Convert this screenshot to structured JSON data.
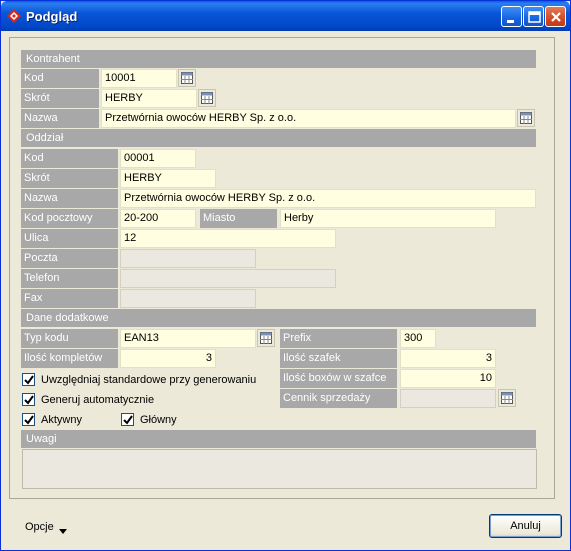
{
  "window": {
    "title": "Podgląd",
    "title_color": "#0a56d8"
  },
  "kontrahent": {
    "header": "Kontrahent",
    "kod_label": "Kod",
    "kod_value": "10001",
    "skrot_label": "Skrót",
    "skrot_value": "HERBY",
    "nazwa_label": "Nazwa",
    "nazwa_value": "Przetwórnia owoców HERBY Sp. z o.o."
  },
  "oddzial": {
    "header": "Oddział",
    "kod_label": "Kod",
    "kod_value": "00001",
    "skrot_label": "Skrót",
    "skrot_value": "HERBY",
    "nazwa_label": "Nazwa",
    "nazwa_value": "Przetwórnia owoców HERBY Sp. z o.o.",
    "kod_pocztowy_label": "Kod pocztowy",
    "kod_pocztowy_value": "20-200",
    "miasto_label": "Miasto",
    "miasto_value": "Herby",
    "ulica_label": "Ulica",
    "ulica_value": "12",
    "poczta_label": "Poczta",
    "poczta_value": "",
    "telefon_label": "Telefon",
    "telefon_value": "",
    "fax_label": "Fax",
    "fax_value": ""
  },
  "dane_dodatkowe": {
    "header": "Dane dodatkowe",
    "typ_kodu_label": "Typ kodu",
    "typ_kodu_value": "EAN13",
    "ilosc_kompletow_label": "Ilość kompletów",
    "ilosc_kompletow_value": "3",
    "prefix_label": "Prefix",
    "prefix_value": "300",
    "ilosc_szafek_label": "Ilość szafek",
    "ilosc_szafek_value": "3",
    "ilosc_boxow_label": "Ilość boxów w szafce",
    "ilosc_boxow_value": "10",
    "cennik_label": "Cennik sprzedaży",
    "cennik_value": "",
    "checkboxes": {
      "uwzgledniaj_label": "Uwzględniaj standardowe przy generowaniu",
      "uwzgledniaj_checked": true,
      "generuj_label": "Generuj automatycznie",
      "generuj_checked": true,
      "aktywny_label": "Aktywny",
      "aktywny_checked": true,
      "glowny_label": "Główny",
      "glowny_checked": true
    }
  },
  "uwagi": {
    "header": "Uwagi",
    "value": ""
  },
  "footer": {
    "opcje_label": "Opcje",
    "anuluj_label": "Anuluj"
  },
  "icons": {
    "title": "app-logo-icon",
    "picker": "calendar-table-icon",
    "dropdown": "triangle-down-icon"
  },
  "colors": {
    "label_bg": "#a8a8a8",
    "input_bg": "#fffee0",
    "panel_bg": "#ece9d8"
  }
}
